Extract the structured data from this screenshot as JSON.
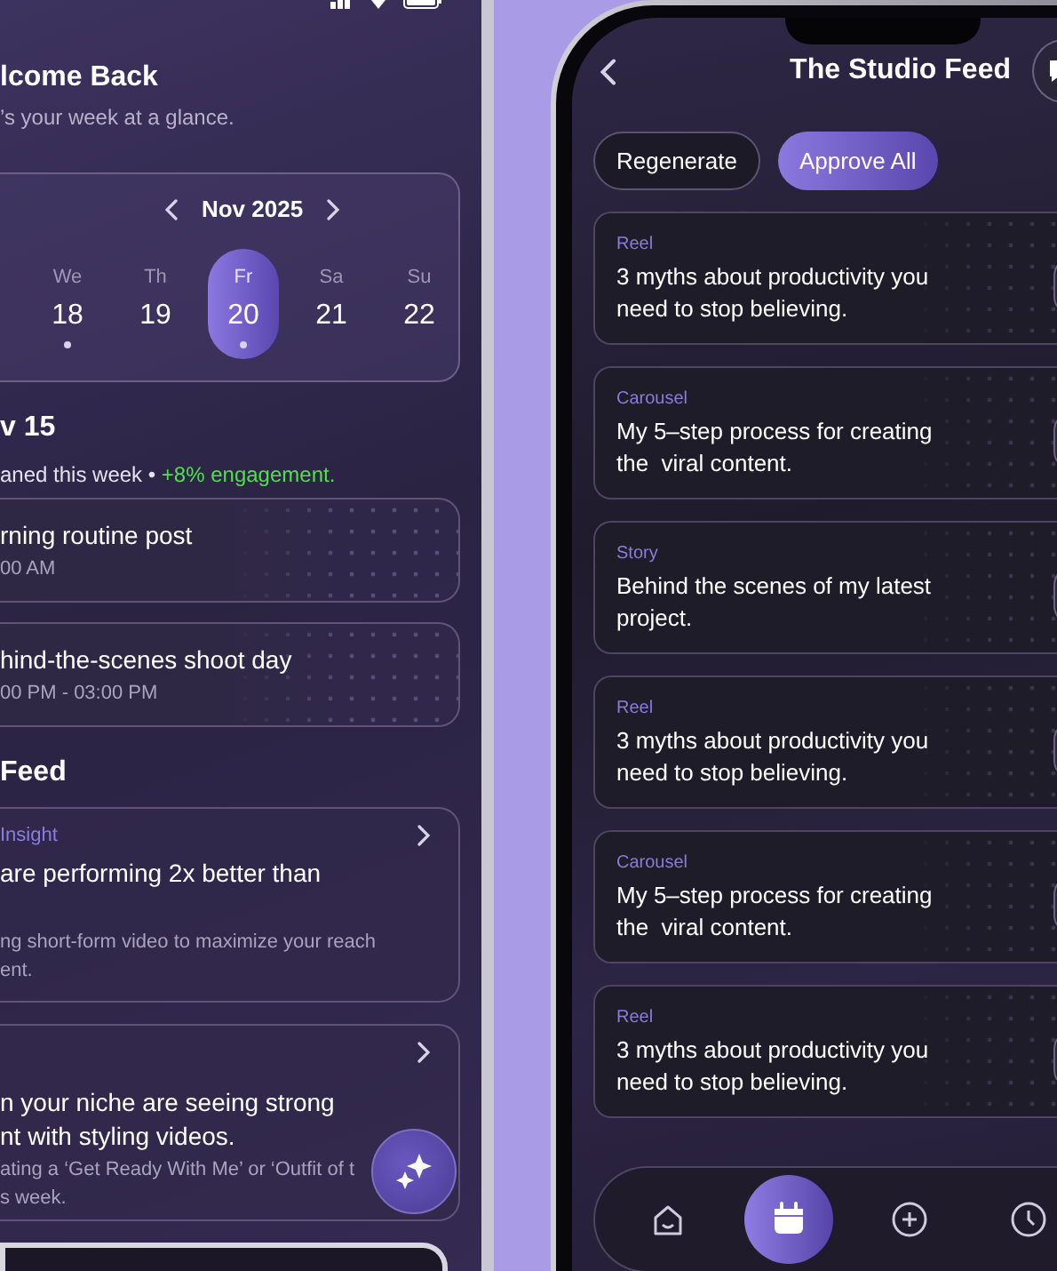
{
  "left_screen": {
    "greeting": "lcome Back",
    "subtitle": "’s your week at a glance.",
    "calendar": {
      "month": "Nov 2025",
      "days": [
        {
          "weekday": "We",
          "date": "18",
          "selected": false,
          "has_event": true
        },
        {
          "weekday": "Th",
          "date": "19",
          "selected": false,
          "has_event": false
        },
        {
          "weekday": "Fr",
          "date": "20",
          "selected": true,
          "has_event": true
        },
        {
          "weekday": "Sa",
          "date": "21",
          "selected": false,
          "has_event": false
        },
        {
          "weekday": "Su",
          "date": "22",
          "selected": false,
          "has_event": false
        }
      ]
    },
    "day_heading": "v 15",
    "summary": {
      "text": "aned this week •",
      "highlight": "+8% engagement."
    },
    "events": [
      {
        "title": "rning routine post",
        "time": "00 AM"
      },
      {
        "title": "hind-the-scenes shoot day",
        "time": "00 PM - 03:00 PM"
      }
    ],
    "feed_heading": "Feed",
    "insights": [
      {
        "tag": "Insight",
        "title_lines": [
          "are performing 2x better than"
        ],
        "body_lines": [
          "ng short-form video to maximize your reach",
          "ent."
        ]
      },
      {
        "title_lines": [
          "n your niche are seeing strong",
          "nt with styling videos."
        ],
        "body_lines": [
          "ating a ‘Get Ready With Me’ or ‘Outfit of t",
          "s week."
        ]
      }
    ]
  },
  "right_screen": {
    "title": "The Studio Feed",
    "buttons": [
      {
        "label": "Regenerate",
        "selected": false
      },
      {
        "label": "Approve All",
        "selected": true
      }
    ],
    "cards": [
      {
        "type": "Reel",
        "title": "3 myths about productivity you need to stop believing."
      },
      {
        "type": "Carousel",
        "title": "My 5–step process for creating the  viral content."
      },
      {
        "type": "Story",
        "title": "Behind the scenes of my latest project."
      },
      {
        "type": "Reel",
        "title": "3 myths about productivity you need to stop believing."
      },
      {
        "type": "Carousel",
        "title": "My 5–step process for creating the  viral content."
      },
      {
        "type": "Reel",
        "title": "3 myths about productivity you need to stop believing."
      }
    ],
    "nav": [
      {
        "kind": "home",
        "selected": false
      },
      {
        "kind": "calendar",
        "selected": true
      },
      {
        "kind": "add",
        "selected": false
      },
      {
        "kind": "history",
        "selected": false
      }
    ]
  }
}
